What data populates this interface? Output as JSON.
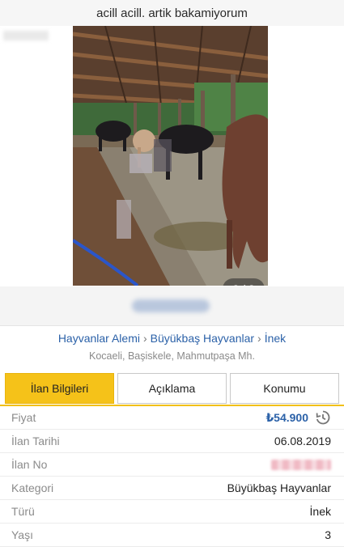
{
  "header": {
    "title": "acill acill. artik bakamiyorum"
  },
  "gallery": {
    "pager_text": "2 / 3"
  },
  "breadcrumb": {
    "items": [
      "Hayvanlar Alemi",
      "Büyükbaş Hayvanlar",
      "İnek"
    ],
    "separator": "›"
  },
  "location": "Kocaeli, Başiskele, Mahmutpaşa Mh.",
  "tabs": [
    {
      "label": "İlan Bilgileri",
      "active": true
    },
    {
      "label": "Açıklama",
      "active": false
    },
    {
      "label": "Konumu",
      "active": false
    }
  ],
  "details": {
    "price": {
      "label": "Fiyat",
      "value": "₺54.900"
    },
    "date": {
      "label": "İlan Tarihi",
      "value": "06.08.2019"
    },
    "number": {
      "label": "İlan No"
    },
    "category": {
      "label": "Kategori",
      "value": "Büyükbaş Hayvanlar"
    },
    "type": {
      "label": "Türü",
      "value": "İnek"
    },
    "age": {
      "label": "Yaşı",
      "value": "3"
    }
  },
  "colors": {
    "accent": "#f5c219",
    "link": "#2b61a8"
  },
  "icons": {
    "price_history": "history-icon"
  }
}
